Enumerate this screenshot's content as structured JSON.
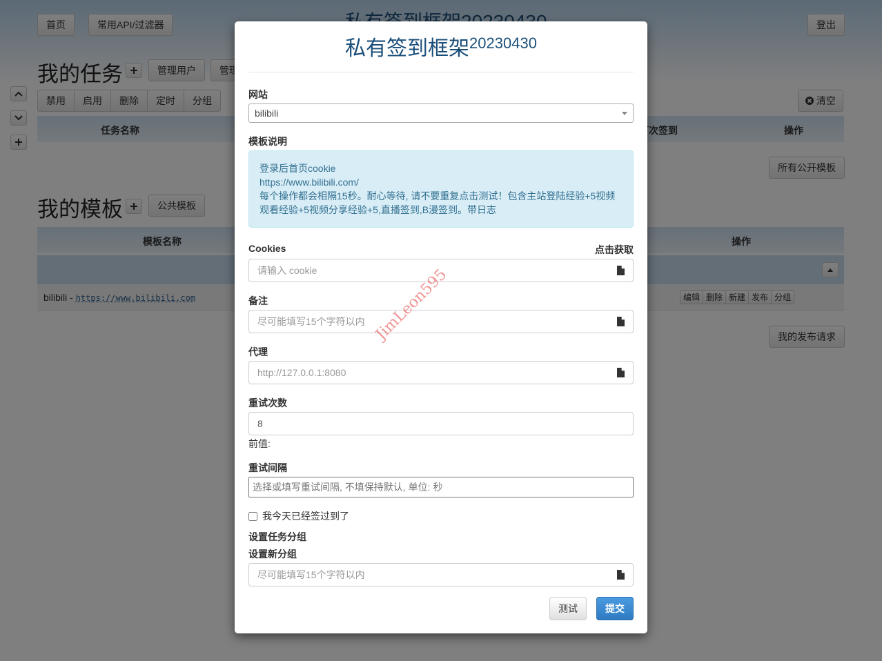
{
  "background": {
    "nav": {
      "home": "首页",
      "api_filter": "常用API/过滤器",
      "logout": "登出"
    },
    "faded_title": "私有签到框架20230430",
    "tasks": {
      "title": "我的任务",
      "manage_users": "管理用户",
      "manage_other": "管理",
      "actions": [
        "禁用",
        "启用",
        "删除",
        "定时",
        "分组"
      ],
      "clear": "清空",
      "columns": [
        "任务名称",
        "下次签到",
        "操作"
      ],
      "all_public_templates": "所有公开模板"
    },
    "templates": {
      "title": "我的模板",
      "public_templates": "公共模板",
      "columns": [
        "模板名称",
        "操作"
      ],
      "row": {
        "name": "bilibili",
        "separator": " - ",
        "url": "https://www.bilibili.com"
      },
      "row_actions": [
        "编辑",
        "删除",
        "新建",
        "发布",
        "分组"
      ],
      "my_publish_requests": "我的发布请求"
    }
  },
  "modal": {
    "title_main": "私有签到框架",
    "title_version": "20230430",
    "site_label": "网站",
    "site_value": "bilibili",
    "template_desc_label": "模板说明",
    "template_desc_lines": [
      "登录后首页cookie",
      "https://www.bilibili.com/",
      "每个操作都会相隔15秒。耐心等待, 请不要重复点击测试！包含主站登陆经验+5视频",
      "观看经验+5视频分享经验+5,直播签到,B漫签到。带日志"
    ],
    "cookies_label": "Cookies",
    "cookies_get": "点击获取",
    "cookies_placeholder": "请输入 cookie",
    "note_label": "备注",
    "note_placeholder": "尽可能填写15个字符以内",
    "proxy_label": "代理",
    "proxy_placeholder": "http://127.0.0.1:8080",
    "retry_count_label": "重试次数",
    "retry_count_value": "8",
    "retry_count_hint": "前值:",
    "retry_interval_label": "重试间隔",
    "retry_interval_placeholder": "选择或填写重试间隔, 不填保持默认, 单位: 秒",
    "already_signed_label": "我今天已经签过到了",
    "group_label": "设置任务分组",
    "new_group_label": "设置新分组",
    "new_group_placeholder": "尽可能填写15个字符以内",
    "test_button": "测试",
    "submit_button": "提交"
  },
  "watermark": "JimLeon595",
  "colors": {
    "accent": "#1b4f7a",
    "primary": "#337ab7",
    "info_bg": "#d9edf7",
    "info_text": "#31708f"
  },
  "icons": [
    "plus-icon",
    "chevron-up-icon",
    "chevron-down-icon",
    "file-icon",
    "close-circle-icon",
    "caret-up-icon"
  ]
}
